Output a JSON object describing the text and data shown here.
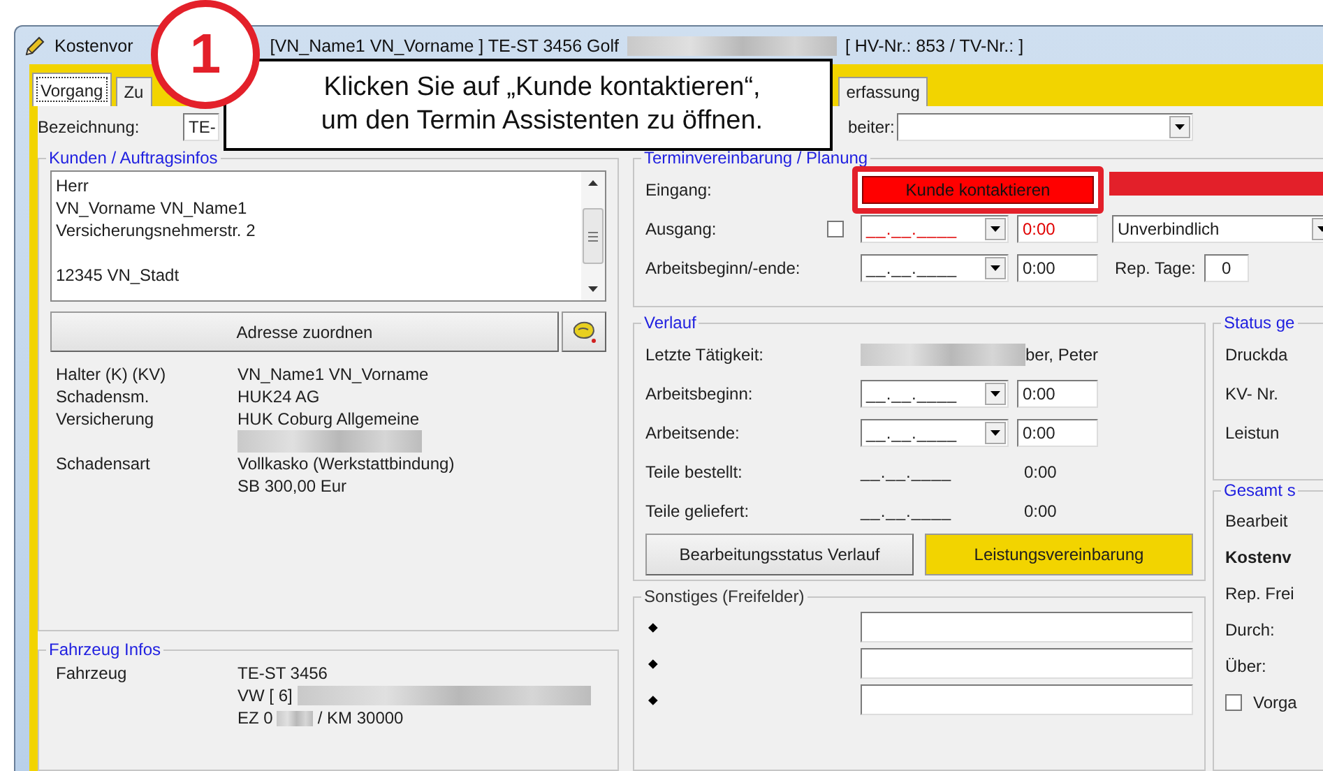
{
  "callout": {
    "number": "1",
    "lines": [
      "Klicken Sie auf „Kunde kontaktieren“,",
      "um den Termin Assistenten zu öffnen."
    ]
  },
  "window": {
    "title_parts": [
      {
        "kind": "text",
        "text": "Kostenvor"
      },
      {
        "kind": "text",
        "text": "[VN_Name1 VN_Vorname ] TE-ST 3456 Golf"
      },
      {
        "kind": "blurred"
      },
      {
        "kind": "text",
        "text": "[ HV-Nr.: 853 / TV-Nr.: ]"
      }
    ]
  },
  "tabs": [
    {
      "label": "Vorgang",
      "selected": true
    },
    {
      "label": "Zu",
      "selected": false
    },
    {
      "label": "erfassung",
      "selected": false
    }
  ],
  "header": {
    "designation_label": "Bezeichnung:",
    "designation_value": "TE-",
    "staff_label": "beiter:"
  },
  "customer": {
    "title": "Kunden / Auftragsinfos",
    "address_lines": [
      {
        "text": "Herr"
      },
      {
        "text": "VN_Vorname VN_Name1"
      },
      {
        "text": "Versicherungsnehmerstr. 2"
      },
      {
        "text": "12345 VN_Stadt",
        "spaced": true
      }
    ],
    "assign_button": "Adresse zuordnen",
    "info_rows": [
      {
        "label": "Halter (K) (KV)",
        "values": [
          {
            "kind": "text",
            "text": "VN_Name1 VN_Vorname"
          }
        ]
      },
      {
        "label": "Schadensm.",
        "values": [
          {
            "kind": "text",
            "text": "HUK24 AG"
          }
        ]
      },
      {
        "label": "Versicherung",
        "values": [
          {
            "kind": "text",
            "text": "HUK Coburg Allgemeine"
          },
          {
            "kind": "blurred"
          }
        ]
      },
      {
        "label": "Schadensart",
        "values": [
          {
            "kind": "text",
            "text": "Vollkasko (Werkstattbindung)"
          },
          {
            "kind": "text",
            "text": "SB 300,00 Eur"
          }
        ]
      }
    ]
  },
  "vehicle": {
    "title": "Fahrzeug Infos",
    "label": "Fahrzeug",
    "lines": [
      [
        {
          "kind": "text",
          "text": "TE-ST 3456"
        }
      ],
      [
        {
          "kind": "text",
          "text": "VW [ 6]"
        },
        {
          "kind": "blurred"
        }
      ],
      [
        {
          "kind": "text",
          "text": "EZ 0"
        },
        {
          "kind": "blurred"
        },
        {
          "kind": "text",
          "text": "/ KM 30000"
        }
      ]
    ]
  },
  "planning": {
    "title": "Terminvereinbarung / Planung",
    "rows": [
      {
        "kind": "button",
        "label": "Eingang:",
        "button": "Kunde kontaktieren"
      },
      {
        "kind": "dates",
        "label": "Ausgang:",
        "checked": false,
        "date": "__.__.____",
        "time": "0:00",
        "warning": true,
        "select": "Unverbindlich"
      },
      {
        "kind": "dates",
        "label": "Arbeitsbeginn/-ende:",
        "date": "__.__.____",
        "time": "0:00",
        "warning": false,
        "extra_label": "Rep. Tage:",
        "extra_value": "0"
      }
    ]
  },
  "history": {
    "title": "Verlauf",
    "rows": [
      {
        "kind": "text",
        "label": "Letzte Tätigkeit:",
        "parts": [
          {
            "kind": "blurred"
          },
          {
            "kind": "text",
            "text": "ber, Peter"
          }
        ]
      },
      {
        "kind": "dates",
        "label": "Arbeitsbeginn:",
        "date": "__.__.____",
        "time": "0:00"
      },
      {
        "kind": "dates",
        "label": "Arbeitsende:",
        "date": "__.__.____",
        "time": "0:00"
      },
      {
        "kind": "plain",
        "label": "Teile bestellt:",
        "date": "__.__.____",
        "time": "0:00"
      },
      {
        "kind": "plain",
        "label": "Teile geliefert:",
        "date": "__.__.____",
        "time": "0:00"
      }
    ],
    "buttons": [
      {
        "label": "Bearbeitungsstatus Verlauf",
        "highlighted": false
      },
      {
        "label": "Leistungsvereinbarung",
        "highlighted": true
      }
    ]
  },
  "misc": {
    "title": "Sonstiges (Freifelder)",
    "rows": [
      {
        "kind": "field"
      },
      {
        "kind": "field"
      },
      {
        "kind": "field"
      }
    ]
  },
  "status": {
    "title": "Status ge",
    "labels": [
      "Druckda",
      "KV- Nr.",
      "Leistun"
    ]
  },
  "totals": {
    "title": "Gesamt s",
    "rows": [
      {
        "kind": "text",
        "label": "Bearbeit"
      },
      {
        "kind": "bold",
        "label": "Kostenv"
      },
      {
        "kind": "text",
        "label": "Rep. Frei"
      },
      {
        "kind": "text",
        "label": "Durch:"
      },
      {
        "kind": "text",
        "label": "Über:"
      },
      {
        "kind": "check",
        "label": "Vorga",
        "checked": false
      }
    ]
  }
}
